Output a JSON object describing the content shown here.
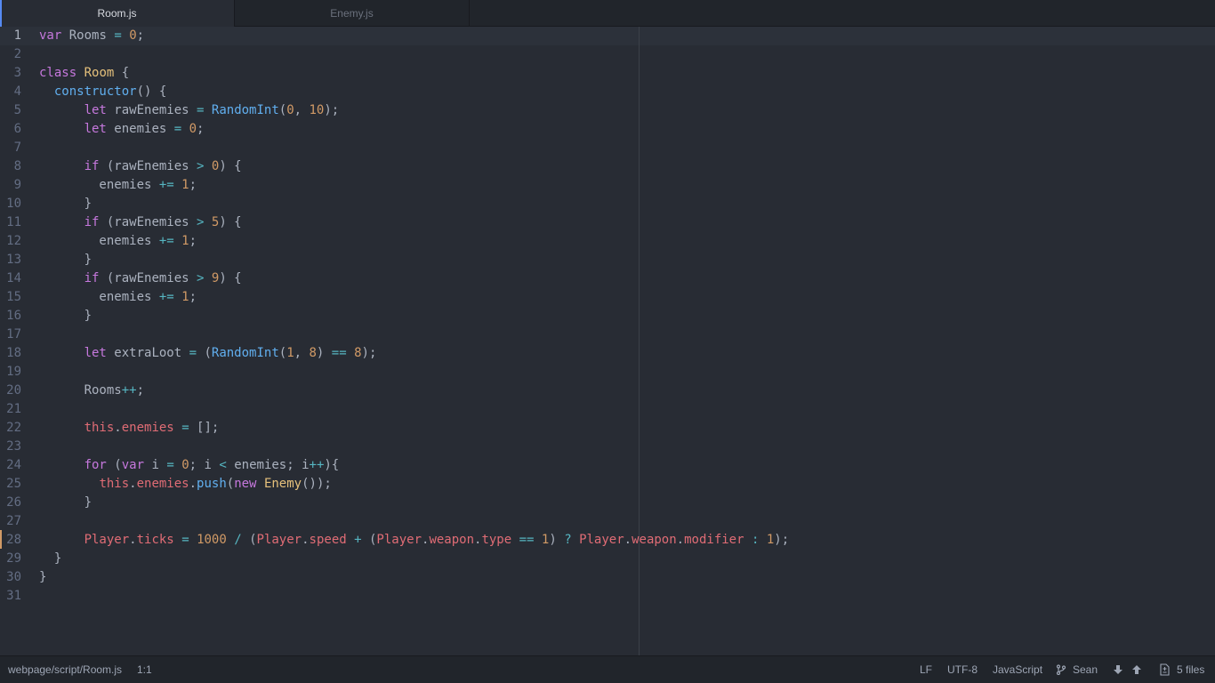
{
  "tabs": [
    {
      "label": "Room.js",
      "active": true
    },
    {
      "label": "Enemy.js",
      "active": false
    }
  ],
  "editor": {
    "current_line": 1,
    "modified_line": 28,
    "lines": [
      [
        [
          "kw",
          "var"
        ],
        [
          "pl",
          " Rooms "
        ],
        [
          "op",
          "="
        ],
        [
          "pl",
          " "
        ],
        [
          "num",
          "0"
        ],
        [
          "pl",
          ";"
        ]
      ],
      [],
      [
        [
          "kw",
          "class"
        ],
        [
          "pl",
          " "
        ],
        [
          "cls",
          "Room"
        ],
        [
          "pl",
          " {"
        ]
      ],
      [
        [
          "pl",
          "  "
        ],
        [
          "fn",
          "constructor"
        ],
        [
          "pl",
          "() {"
        ]
      ],
      [
        [
          "pl",
          "      "
        ],
        [
          "kw",
          "let"
        ],
        [
          "pl",
          " rawEnemies "
        ],
        [
          "op",
          "="
        ],
        [
          "pl",
          " "
        ],
        [
          "fn",
          "RandomInt"
        ],
        [
          "pl",
          "("
        ],
        [
          "num",
          "0"
        ],
        [
          "pl",
          ", "
        ],
        [
          "num",
          "10"
        ],
        [
          "pl",
          ");"
        ]
      ],
      [
        [
          "pl",
          "      "
        ],
        [
          "kw",
          "let"
        ],
        [
          "pl",
          " enemies "
        ],
        [
          "op",
          "="
        ],
        [
          "pl",
          " "
        ],
        [
          "num",
          "0"
        ],
        [
          "pl",
          ";"
        ]
      ],
      [],
      [
        [
          "pl",
          "      "
        ],
        [
          "kw",
          "if"
        ],
        [
          "pl",
          " (rawEnemies "
        ],
        [
          "op",
          ">"
        ],
        [
          "pl",
          " "
        ],
        [
          "num",
          "0"
        ],
        [
          "pl",
          ") {"
        ]
      ],
      [
        [
          "pl",
          "        enemies "
        ],
        [
          "op",
          "+="
        ],
        [
          "pl",
          " "
        ],
        [
          "num",
          "1"
        ],
        [
          "pl",
          ";"
        ]
      ],
      [
        [
          "pl",
          "      }"
        ]
      ],
      [
        [
          "pl",
          "      "
        ],
        [
          "kw",
          "if"
        ],
        [
          "pl",
          " (rawEnemies "
        ],
        [
          "op",
          ">"
        ],
        [
          "pl",
          " "
        ],
        [
          "num",
          "5"
        ],
        [
          "pl",
          ") {"
        ]
      ],
      [
        [
          "pl",
          "        enemies "
        ],
        [
          "op",
          "+="
        ],
        [
          "pl",
          " "
        ],
        [
          "num",
          "1"
        ],
        [
          "pl",
          ";"
        ]
      ],
      [
        [
          "pl",
          "      }"
        ]
      ],
      [
        [
          "pl",
          "      "
        ],
        [
          "kw",
          "if"
        ],
        [
          "pl",
          " (rawEnemies "
        ],
        [
          "op",
          ">"
        ],
        [
          "pl",
          " "
        ],
        [
          "num",
          "9"
        ],
        [
          "pl",
          ") {"
        ]
      ],
      [
        [
          "pl",
          "        enemies "
        ],
        [
          "op",
          "+="
        ],
        [
          "pl",
          " "
        ],
        [
          "num",
          "1"
        ],
        [
          "pl",
          ";"
        ]
      ],
      [
        [
          "pl",
          "      }"
        ]
      ],
      [],
      [
        [
          "pl",
          "      "
        ],
        [
          "kw",
          "let"
        ],
        [
          "pl",
          " extraLoot "
        ],
        [
          "op",
          "="
        ],
        [
          "pl",
          " ("
        ],
        [
          "fn",
          "RandomInt"
        ],
        [
          "pl",
          "("
        ],
        [
          "num",
          "1"
        ],
        [
          "pl",
          ", "
        ],
        [
          "num",
          "8"
        ],
        [
          "pl",
          ") "
        ],
        [
          "op",
          "=="
        ],
        [
          "pl",
          " "
        ],
        [
          "num",
          "8"
        ],
        [
          "pl",
          ");"
        ]
      ],
      [],
      [
        [
          "pl",
          "      Rooms"
        ],
        [
          "op",
          "++"
        ],
        [
          "pl",
          ";"
        ]
      ],
      [],
      [
        [
          "pl",
          "      "
        ],
        [
          "thisv",
          "this"
        ],
        [
          "pl",
          "."
        ],
        [
          "prop",
          "enemies"
        ],
        [
          "pl",
          " "
        ],
        [
          "op",
          "="
        ],
        [
          "pl",
          " [];"
        ]
      ],
      [],
      [
        [
          "pl",
          "      "
        ],
        [
          "kw",
          "for"
        ],
        [
          "pl",
          " ("
        ],
        [
          "kw",
          "var"
        ],
        [
          "pl",
          " i "
        ],
        [
          "op",
          "="
        ],
        [
          "pl",
          " "
        ],
        [
          "num",
          "0"
        ],
        [
          "pl",
          "; i "
        ],
        [
          "op",
          "<"
        ],
        [
          "pl",
          " enemies; i"
        ],
        [
          "op",
          "++"
        ],
        [
          "pl",
          "){"
        ]
      ],
      [
        [
          "pl",
          "        "
        ],
        [
          "thisv",
          "this"
        ],
        [
          "pl",
          "."
        ],
        [
          "prop",
          "enemies"
        ],
        [
          "pl",
          "."
        ],
        [
          "fn",
          "push"
        ],
        [
          "pl",
          "("
        ],
        [
          "kw",
          "new"
        ],
        [
          "pl",
          " "
        ],
        [
          "cls",
          "Enemy"
        ],
        [
          "pl",
          "());"
        ]
      ],
      [
        [
          "pl",
          "      }"
        ]
      ],
      [],
      [
        [
          "pl",
          "      "
        ],
        [
          "obj",
          "Player"
        ],
        [
          "pl",
          "."
        ],
        [
          "prop",
          "ticks"
        ],
        [
          "pl",
          " "
        ],
        [
          "op",
          "="
        ],
        [
          "pl",
          " "
        ],
        [
          "num",
          "1000"
        ],
        [
          "pl",
          " "
        ],
        [
          "op",
          "/"
        ],
        [
          "pl",
          " ("
        ],
        [
          "obj",
          "Player"
        ],
        [
          "pl",
          "."
        ],
        [
          "prop",
          "speed"
        ],
        [
          "pl",
          " "
        ],
        [
          "op",
          "+"
        ],
        [
          "pl",
          " ("
        ],
        [
          "obj",
          "Player"
        ],
        [
          "pl",
          "."
        ],
        [
          "prop",
          "weapon"
        ],
        [
          "pl",
          "."
        ],
        [
          "prop",
          "type"
        ],
        [
          "pl",
          " "
        ],
        [
          "op",
          "=="
        ],
        [
          "pl",
          " "
        ],
        [
          "num",
          "1"
        ],
        [
          "pl",
          ") "
        ],
        [
          "op",
          "?"
        ],
        [
          "pl",
          " "
        ],
        [
          "obj",
          "Player"
        ],
        [
          "pl",
          "."
        ],
        [
          "prop",
          "weapon"
        ],
        [
          "pl",
          "."
        ],
        [
          "prop",
          "modifier"
        ],
        [
          "pl",
          " "
        ],
        [
          "op",
          ":"
        ],
        [
          "pl",
          " "
        ],
        [
          "num",
          "1"
        ],
        [
          "pl",
          ");"
        ]
      ],
      [
        [
          "pl",
          "  }"
        ]
      ],
      [
        [
          "pl",
          "}"
        ]
      ],
      []
    ]
  },
  "status": {
    "file_path": "webpage/script/Room.js",
    "cursor_pos": "1:1",
    "line_ending": "LF",
    "encoding": "UTF-8",
    "grammar": "JavaScript",
    "branch": "Sean",
    "files_count": "5 files",
    "branch_icon": "git-branch-icon",
    "fetch_icon": "arrow-down-icon",
    "push_icon": "arrow-up-icon",
    "diff_icon": "file-diff-icon"
  }
}
